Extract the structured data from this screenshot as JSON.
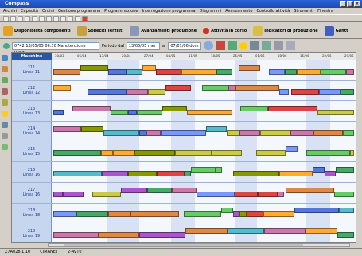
{
  "window": {
    "title": "Compass"
  },
  "menu": [
    "Archivi",
    "Capacità",
    "Ordini",
    "Gestione programma",
    "Programmazione",
    "Interrogazione programma",
    "Diagrammi",
    "Avanzamento",
    "Controllo attività",
    "Strumenti",
    "Finestra"
  ],
  "toolbar2": {
    "btn1": "Disponibilità componenti",
    "btn2": "Solleciti Terzisti",
    "btn3": "Avanzamenti produzione",
    "btn4": "Attività in corso",
    "btn5": "Indicatori di produzione",
    "btn6": "Gantt"
  },
  "toolbar3": {
    "selector": "0742 13/05/05 06:30 Manutenzione ILIO2",
    "period_label": "Periodo dal",
    "date_from": "13/05/05 mer",
    "al_label": "al",
    "date_to": "07/01/06 dom"
  },
  "grid": {
    "header": "Macchine",
    "dates": [
      "30/03",
      "06/04",
      "13/04",
      "20/04",
      "27/04",
      "04/05",
      "11/05",
      "18/05",
      "25/05",
      "01/06",
      "08/06",
      "15/06",
      "22/06",
      "29/06"
    ],
    "machines": [
      {
        "code": "211",
        "line": "Linea 11"
      },
      {
        "code": "212",
        "line": "Linea 12"
      },
      {
        "code": "213",
        "line": "Linea 13"
      },
      {
        "code": "214",
        "line": "Linea 14"
      },
      {
        "code": "215",
        "line": "Linea 15"
      },
      {
        "code": "216",
        "line": "Linea 16"
      },
      {
        "code": "217",
        "line": "Linea 16"
      },
      {
        "code": "218",
        "line": "Linea 18"
      },
      {
        "code": "219",
        "line": "Linea 19"
      }
    ]
  },
  "status": {
    "s1": "Z7A028 1.10",
    "s2": "CIMANET",
    "s3": "2-AVT0"
  }
}
